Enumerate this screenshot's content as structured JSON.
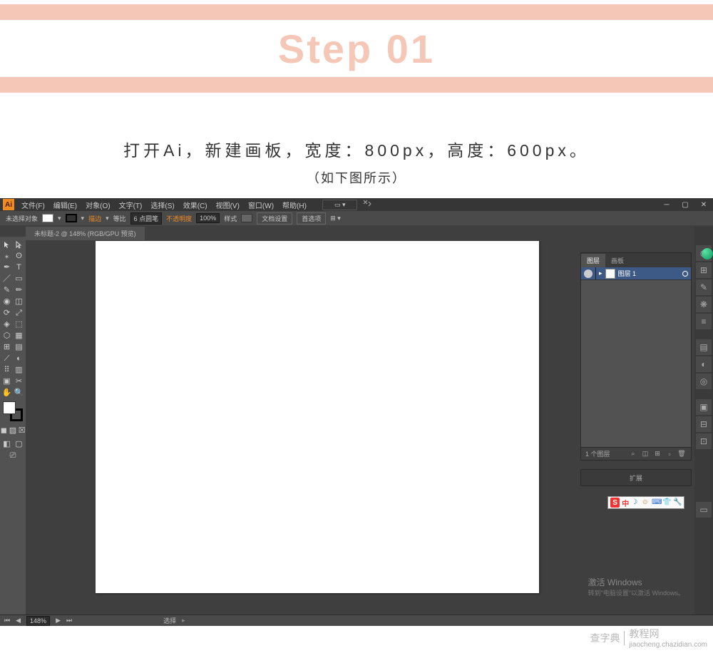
{
  "header": {
    "step_title": "Step 01",
    "desc_line1": "打开Ai，新建画板，宽度：800px，高度：600px。",
    "desc_line2": "（如下图所示）"
  },
  "ai": {
    "menus": [
      "文件(F)",
      "编辑(E)",
      "对象(O)",
      "文字(T)",
      "选择(S)",
      "效果(C)",
      "视图(V)",
      "窗口(W)",
      "帮助(H)"
    ],
    "optbar": {
      "noselect": "未选择对象",
      "stroke": "描边",
      "stroke_weight": "6 点圆笔",
      "equal": "等比",
      "opacity_label": "不透明度",
      "opacity_value": "100%",
      "style": "样式",
      "docsetup": "文档设置",
      "prefs": "首选项"
    },
    "doctab": "未标题-2 @ 148% (RGB/GPU 预览)",
    "layer_panel": {
      "tab1": "图层",
      "tab2": "画板",
      "layer_name": "图层 1",
      "footer": "1 个图层"
    },
    "ext_panel": "扩展",
    "watermark": {
      "title": "激活 Windows",
      "sub": "转到\"电脑设置\"以激活 Windows。"
    },
    "status": {
      "zoom": "148%",
      "sel": "选择"
    },
    "ime": {
      "zh": "中"
    }
  },
  "site_wm": {
    "main": "查字典",
    "sub": "教程网",
    "url": "jiaocheng.chazidian.com"
  }
}
